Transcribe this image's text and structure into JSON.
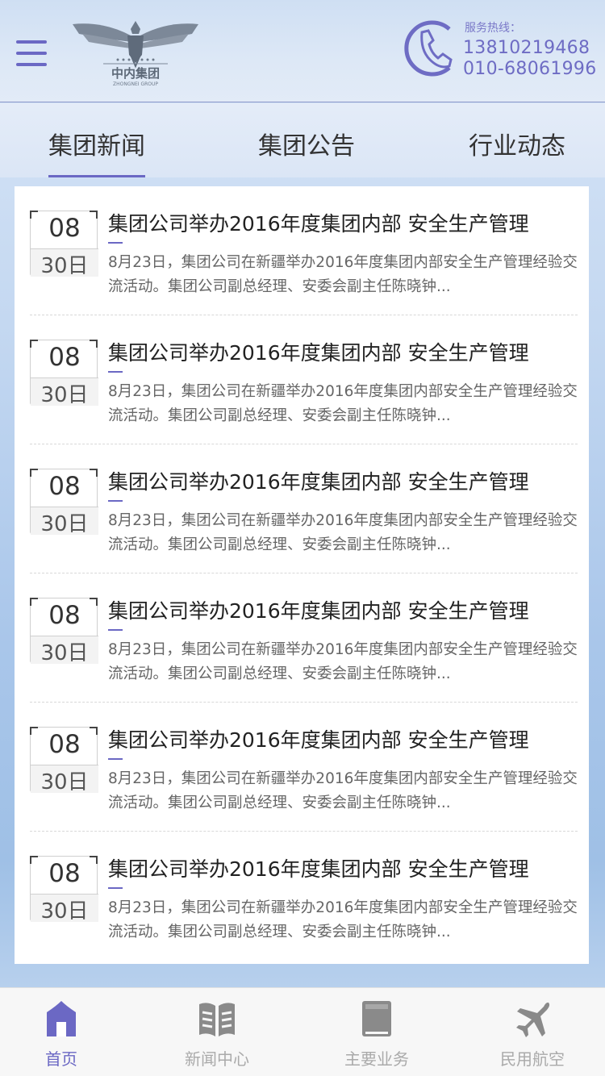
{
  "header": {
    "logo_text": "中内集团",
    "logo_subtext": "ZHONGNEI GROUP",
    "hotline_label": "服务热线：",
    "hotline_number_1": "13810219468",
    "hotline_number_2": "010-68061996"
  },
  "tabs": [
    {
      "label": "集团新闻",
      "active": true
    },
    {
      "label": "集团公告",
      "active": false
    },
    {
      "label": "行业动态",
      "active": false
    }
  ],
  "news": [
    {
      "month": "08",
      "day": "30日",
      "title": "集团公司举办2016年度集团内部 安全生产管理",
      "summary": "8月23日，集团公司在新疆举办2016年度集团内部安全生产管理经验交流活动。集团公司副总经理、安委会副主任陈晓钟..."
    },
    {
      "month": "08",
      "day": "30日",
      "title": "集团公司举办2016年度集团内部 安全生产管理",
      "summary": "8月23日，集团公司在新疆举办2016年度集团内部安全生产管理经验交流活动。集团公司副总经理、安委会副主任陈晓钟..."
    },
    {
      "month": "08",
      "day": "30日",
      "title": "集团公司举办2016年度集团内部 安全生产管理",
      "summary": "8月23日，集团公司在新疆举办2016年度集团内部安全生产管理经验交流活动。集团公司副总经理、安委会副主任陈晓钟..."
    },
    {
      "month": "08",
      "day": "30日",
      "title": "集团公司举办2016年度集团内部 安全生产管理",
      "summary": "8月23日，集团公司在新疆举办2016年度集团内部安全生产管理经验交流活动。集团公司副总经理、安委会副主任陈晓钟..."
    },
    {
      "month": "08",
      "day": "30日",
      "title": "集团公司举办2016年度集团内部 安全生产管理",
      "summary": "8月23日，集团公司在新疆举办2016年度集团内部安全生产管理经验交流活动。集团公司副总经理、安委会副主任陈晓钟..."
    },
    {
      "month": "08",
      "day": "30日",
      "title": "集团公司举办2016年度集团内部 安全生产管理",
      "summary": "8月23日，集团公司在新疆举办2016年度集团内部安全生产管理经验交流活动。集团公司副总经理、安委会副主任陈晓钟..."
    }
  ],
  "bottom_nav": [
    {
      "label": "首页",
      "icon": "home-icon",
      "active": true
    },
    {
      "label": "新闻中心",
      "icon": "book-icon",
      "active": false
    },
    {
      "label": "主要业务",
      "icon": "folder-icon",
      "active": false
    },
    {
      "label": "民用航空",
      "icon": "airplane-icon",
      "active": false
    }
  ],
  "colors": {
    "accent": "#6b68c4",
    "inactive": "#aaaaaa",
    "text": "#222222"
  }
}
